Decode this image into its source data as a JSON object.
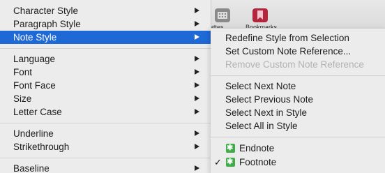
{
  "toolbar": {
    "palettes_label": "alettes",
    "bookmarks_label": "Bookmarks"
  },
  "menu": {
    "items": [
      {
        "label": "Character Style"
      },
      {
        "label": "Paragraph Style"
      },
      {
        "label": "Note Style"
      },
      {
        "label": "Language"
      },
      {
        "label": "Font"
      },
      {
        "label": "Font Face"
      },
      {
        "label": "Size"
      },
      {
        "label": "Letter Case"
      },
      {
        "label": "Underline"
      },
      {
        "label": "Strikethrough"
      },
      {
        "label": "Baseline"
      }
    ]
  },
  "submenu": {
    "items": [
      {
        "label": "Redefine Style from Selection"
      },
      {
        "label": "Set Custom Note Reference..."
      },
      {
        "label": "Remove Custom Note Reference"
      },
      {
        "label": "Select Next Note"
      },
      {
        "label": "Select Previous Note"
      },
      {
        "label": "Select Next in Style"
      },
      {
        "label": "Select All in Style"
      },
      {
        "label": "Endnote"
      },
      {
        "label": "Footnote"
      }
    ],
    "check_mark": "✓"
  },
  "colors": {
    "selection": "#1f69d6",
    "note_icon": "#3fae49",
    "disabled_text": "#b3b3b3"
  }
}
